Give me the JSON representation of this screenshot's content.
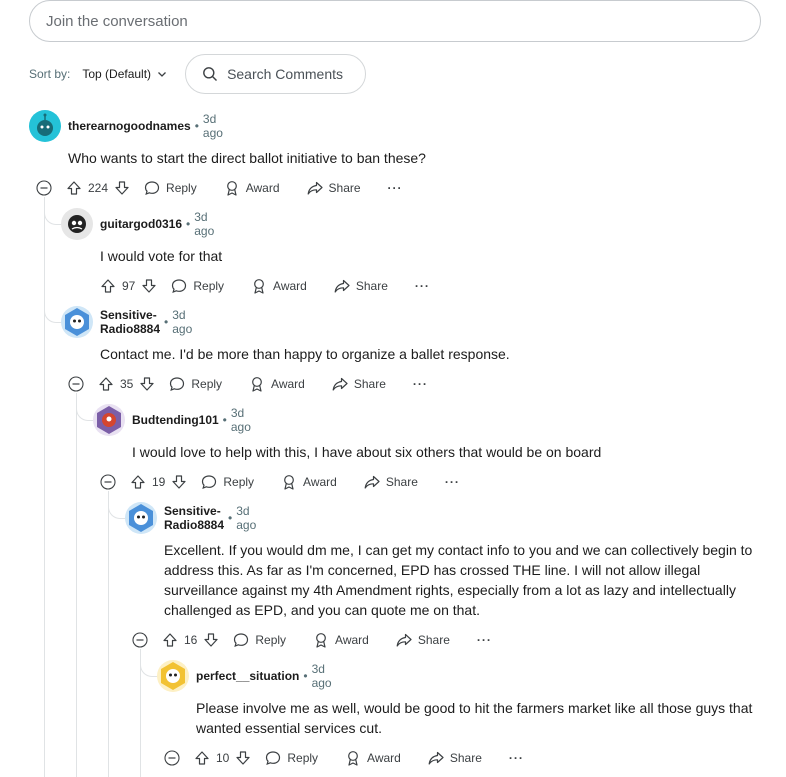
{
  "composer": {
    "placeholder": "Join the conversation"
  },
  "sort": {
    "label": "Sort by:",
    "value": "Top (Default)"
  },
  "search": {
    "label": "Search Comments"
  },
  "actions": {
    "reply": "Reply",
    "award": "Award",
    "share": "Share",
    "more": "···"
  },
  "comments": [
    {
      "author": "therearnogoodnames",
      "age": "3d ago",
      "body": "Who wants to start the direct ballot initiative to ban these?",
      "votes": "224",
      "avatar_color": "#24c2d8"
    },
    {
      "author": "guitargod0316",
      "age": "3d ago",
      "body": "I would vote for that",
      "votes": "97",
      "avatar_color": "#e6e6e6"
    },
    {
      "author": "Sensitive-Radio8884",
      "age": "3d ago",
      "body": "Contact me. I'd be more than happy to organize a ballet response.",
      "votes": "35",
      "avatar_color": "#4a90d9"
    },
    {
      "author": "Budtending101",
      "age": "3d ago",
      "body": "I would love to help with this, I have about six others that would be on board",
      "votes": "19",
      "avatar_color": "#7b5ea7"
    },
    {
      "author": "Sensitive-Radio8884",
      "age": "3d ago",
      "body": "Excellent. If you would dm me, I can get my contact info to you and we can collectively begin to address this. As far as I'm concerned, EPD has crossed THE line. I will not allow illegal surveillance against my 4th Amendment rights, especially from a lot as lazy and intellectually challenged as EPD, and you can quote me on that.",
      "votes": "16",
      "avatar_color": "#4a90d9"
    },
    {
      "author": "perfect__situation",
      "age": "3d ago",
      "body": "Please involve me as well, would be good to hit the farmers market like all those guys that wanted essential services cut.",
      "votes": "10",
      "avatar_color": "#f2c233"
    }
  ]
}
